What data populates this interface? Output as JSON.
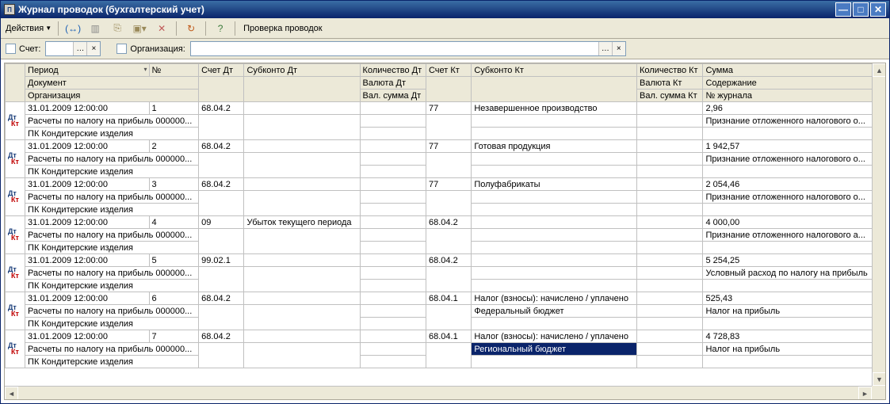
{
  "window": {
    "title": "Журнал проводок (бухгалтерский учет)"
  },
  "toolbar": {
    "actions_label": "Действия",
    "check_label": "Проверка проводок"
  },
  "filter": {
    "account_label": "Счет:",
    "org_label": "Организация:",
    "account_value": "",
    "org_value": ""
  },
  "headers": {
    "row1": {
      "period": "Период",
      "no": "№",
      "acc_dt": "Счет Дт",
      "sub_dt": "Субконто Дт",
      "qty_dt": "Количество Дт",
      "acc_kt": "Счет Кт",
      "sub_kt": "Субконто Кт",
      "qty_kt": "Количество Кт",
      "sum": "Сумма"
    },
    "row2": {
      "doc": "Документ",
      "cur_dt": "Валюта Дт",
      "cur_kt": "Валюта Кт",
      "content": "Содержание"
    },
    "row3": {
      "org": "Организация",
      "valsum_dt": "Вал. сумма Дт",
      "valsum_kt": "Вал. сумма Кт",
      "journal": "№ журнала"
    }
  },
  "rows": [
    {
      "period": "31.01.2009 12:00:00",
      "no": "1",
      "acc_dt": "68.04.2",
      "sub_dt": "",
      "qty_dt": "",
      "acc_kt": "77",
      "sub_kt": "Незавершенное производство",
      "qty_kt": "",
      "sum": "2,96",
      "doc": "Расчеты по налогу на прибыль 000000...",
      "cur_dt": "",
      "sub_kt2": "",
      "cur_kt": "",
      "content": "Признание отложенного налогового о...",
      "org": "ПК Кондитерские изделия",
      "valsum_dt": "",
      "valsum_kt": "",
      "journal": ""
    },
    {
      "period": "31.01.2009 12:00:00",
      "no": "2",
      "acc_dt": "68.04.2",
      "sub_dt": "",
      "qty_dt": "",
      "acc_kt": "77",
      "sub_kt": "Готовая продукция",
      "qty_kt": "",
      "sum": "1 942,57",
      "doc": "Расчеты по налогу на прибыль 000000...",
      "cur_dt": "",
      "sub_kt2": "",
      "cur_kt": "",
      "content": "Признание отложенного налогового о...",
      "org": "ПК Кондитерские изделия",
      "valsum_dt": "",
      "valsum_kt": "",
      "journal": ""
    },
    {
      "period": "31.01.2009 12:00:00",
      "no": "3",
      "acc_dt": "68.04.2",
      "sub_dt": "",
      "qty_dt": "",
      "acc_kt": "77",
      "sub_kt": "Полуфабрикаты",
      "qty_kt": "",
      "sum": "2 054,46",
      "doc": "Расчеты по налогу на прибыль 000000...",
      "cur_dt": "",
      "sub_kt2": "",
      "cur_kt": "",
      "content": "Признание отложенного налогового о...",
      "org": "ПК Кондитерские изделия",
      "valsum_dt": "",
      "valsum_kt": "",
      "journal": ""
    },
    {
      "period": "31.01.2009 12:00:00",
      "no": "4",
      "acc_dt": "09",
      "sub_dt": "Убыток текущего периода",
      "qty_dt": "",
      "acc_kt": "68.04.2",
      "sub_kt": "",
      "qty_kt": "",
      "sum": "4 000,00",
      "doc": "Расчеты по налогу на прибыль 000000...",
      "cur_dt": "",
      "sub_kt2": "",
      "cur_kt": "",
      "content": "Признание отложенного налогового а...",
      "org": "ПК Кондитерские изделия",
      "valsum_dt": "",
      "valsum_kt": "",
      "journal": ""
    },
    {
      "period": "31.01.2009 12:00:00",
      "no": "5",
      "acc_dt": "99.02.1",
      "sub_dt": "",
      "qty_dt": "",
      "acc_kt": "68.04.2",
      "sub_kt": "",
      "qty_kt": "",
      "sum": "5 254,25",
      "doc": "Расчеты по налогу на прибыль 000000...",
      "cur_dt": "",
      "sub_kt2": "",
      "cur_kt": "",
      "content": "Условный расход по налогу на прибыль",
      "org": "ПК Кондитерские изделия",
      "valsum_dt": "",
      "valsum_kt": "",
      "journal": ""
    },
    {
      "period": "31.01.2009 12:00:00",
      "no": "6",
      "acc_dt": "68.04.2",
      "sub_dt": "",
      "qty_dt": "",
      "acc_kt": "68.04.1",
      "sub_kt": "Налог (взносы): начислено / уплачено",
      "qty_kt": "",
      "sum": "525,43",
      "doc": "Расчеты по налогу на прибыль 000000...",
      "cur_dt": "",
      "sub_kt2": "Федеральный бюджет",
      "cur_kt": "",
      "content": "Налог на прибыль",
      "org": "ПК Кондитерские изделия",
      "valsum_dt": "",
      "valsum_kt": "",
      "journal": ""
    },
    {
      "period": "31.01.2009 12:00:00",
      "no": "7",
      "acc_dt": "68.04.2",
      "sub_dt": "",
      "qty_dt": "",
      "acc_kt": "68.04.1",
      "sub_kt": "Налог (взносы): начислено / уплачено",
      "qty_kt": "",
      "sum": "4 728,83",
      "doc": "Расчеты по налогу на прибыль 000000...",
      "cur_dt": "",
      "sub_kt2": "Региональный бюджет",
      "sub_kt2_selected": true,
      "cur_kt": "",
      "content": "Налог на прибыль",
      "org": "ПК Кондитерские изделия",
      "valsum_dt": "",
      "valsum_kt": "",
      "journal": ""
    }
  ]
}
